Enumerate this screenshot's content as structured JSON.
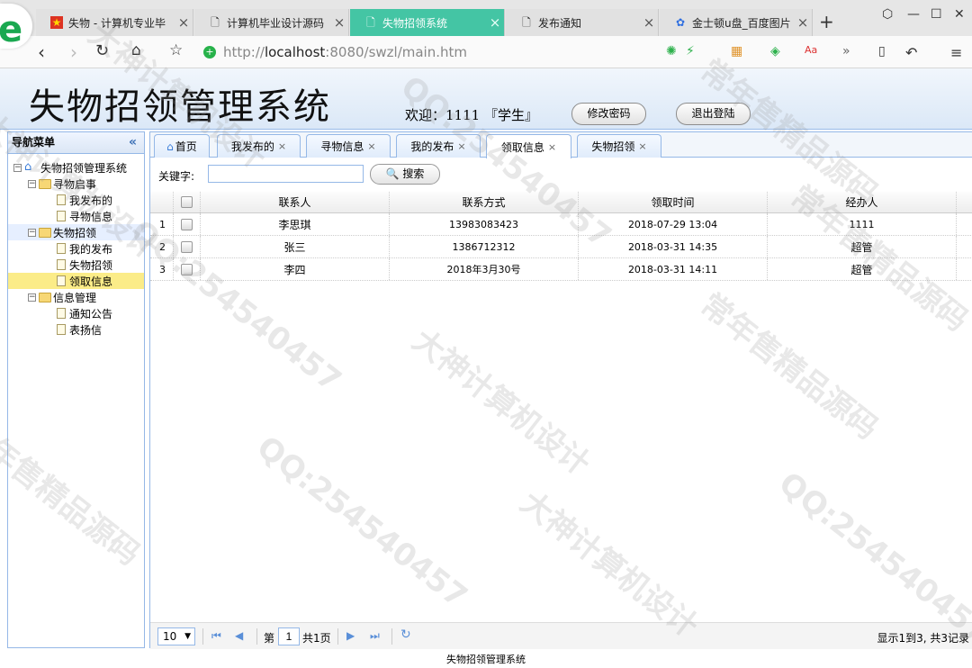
{
  "browser": {
    "tabs": [
      {
        "label": "失物 - 计算机专业毕",
        "icon": "red-flag-icon",
        "left": 0
      },
      {
        "label": "计算机毕业设计源码",
        "icon": "page-icon"
      },
      {
        "label": "失物招领系统",
        "icon": "page-icon",
        "active": true
      },
      {
        "label": "发布通知",
        "icon": "page-icon"
      },
      {
        "label": "金士顿u盘_百度图片",
        "icon": "paw-icon"
      }
    ],
    "url_prefix": "http://",
    "url_host": "localhost",
    "url_rest": ":8080/swzl/main.htm"
  },
  "header": {
    "title": "失物招领管理系统",
    "welcome": "欢迎：1111 『学生』",
    "change_password": "修改密码",
    "logout": "退出登陆"
  },
  "sidebar": {
    "title": "导航菜单",
    "root": "失物招领管理系统",
    "groups": [
      {
        "label": "寻物启事",
        "items": [
          "我发布的",
          "寻物信息"
        ]
      },
      {
        "label": "失物招领",
        "items": [
          "我的发布",
          "失物招领",
          "领取信息"
        ]
      },
      {
        "label": "信息管理",
        "items": [
          "通知公告",
          "表扬信"
        ]
      }
    ]
  },
  "main_tabs": [
    "首页",
    "我发布的",
    "寻物信息",
    "我的发布",
    "领取信息",
    "失物招领"
  ],
  "search": {
    "label": "关键字:",
    "value": "",
    "button": "搜索"
  },
  "grid": {
    "columns": [
      "联系人",
      "联系方式",
      "领取时间",
      "经办人"
    ],
    "rows": [
      {
        "n": "1",
        "contact": "李思琪",
        "phone": "13983083423",
        "time": "2018-07-29 13:04",
        "handler": "1111"
      },
      {
        "n": "2",
        "contact": "张三",
        "phone": "1386712312",
        "time": "2018-03-31 14:35",
        "handler": "超管"
      },
      {
        "n": "3",
        "contact": "李四",
        "phone": "2018年3月30号",
        "time": "2018-03-31 14:11",
        "handler": "超管"
      }
    ]
  },
  "pager": {
    "page_size": "10",
    "page_label": "第",
    "page_value": "1",
    "total_pages": "共1页",
    "info": "显示1到3, 共3记录"
  },
  "footer": "失物招领管理系统",
  "watermarks": [
    "大神计算机设计",
    "QQ:254540457",
    "常年售精品源码",
    "QQ:254540457",
    "大神计算机设计",
    "常年售精品源码",
    "QQ:254540457",
    "大神计算机设计",
    "常年售精品源码",
    "QQ:254540457",
    "大神计算机设计",
    "常年售精品源码"
  ]
}
